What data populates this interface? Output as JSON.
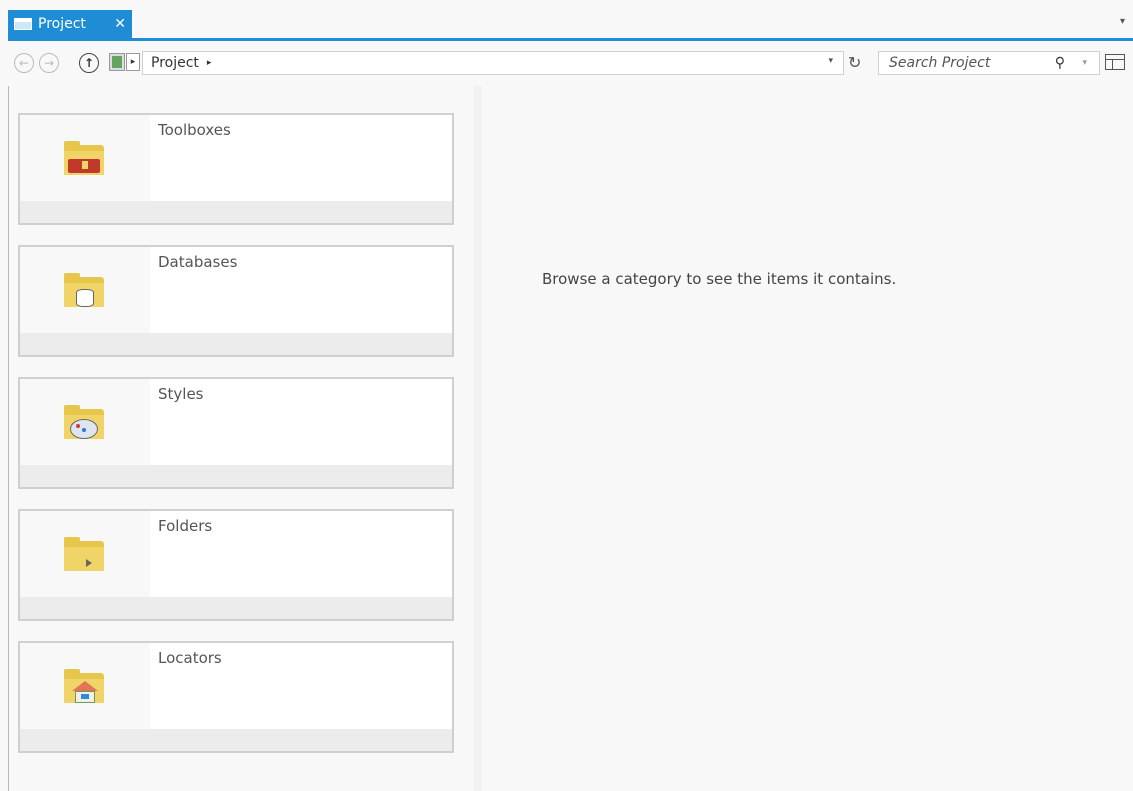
{
  "tab": {
    "title": "Project",
    "close": "✕",
    "menu": "▾"
  },
  "nav": {
    "back": "←",
    "forward": "→",
    "up": "↑",
    "path_item": "Project",
    "path_sep": "▸",
    "loc_arrow": "▸",
    "path_dropdown": "▾",
    "refresh": "↻"
  },
  "search": {
    "placeholder": "Search Project",
    "icon": "⚲",
    "dropdown": "▾"
  },
  "cards": [
    {
      "label": "Toolboxes",
      "icon": "toolbox-folder-icon"
    },
    {
      "label": "Databases",
      "icon": "database-folder-icon"
    },
    {
      "label": "Styles",
      "icon": "styles-folder-icon"
    },
    {
      "label": "Folders",
      "icon": "folder-icon"
    },
    {
      "label": "Locators",
      "icon": "locator-folder-icon"
    }
  ],
  "main": {
    "message": "Browse a category to see the items it contains."
  },
  "colors": {
    "accent": "#1f8dd6",
    "folder": "#e6c64b"
  }
}
